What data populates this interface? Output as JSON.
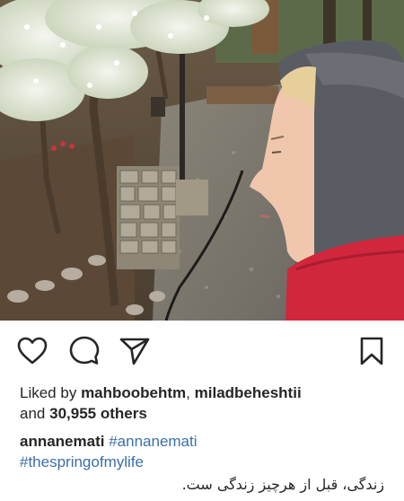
{
  "post": {
    "image_alt": "Woman in a gray hood and red jacket looking at a spring garden with blossoming trees and a stone pillar"
  },
  "actions": {
    "like_icon": "heart-icon",
    "comment_icon": "speech-bubble-icon",
    "share_icon": "paper-plane-icon",
    "save_icon": "bookmark-icon"
  },
  "likes": {
    "prefix": "Liked by",
    "user1": "mahboobehtm",
    "separator": ",",
    "user2": "miladbeheshtii",
    "and": "and",
    "count": "30,955 others"
  },
  "caption": {
    "username": "annanemati",
    "hashtag1": "#annanemati",
    "hashtag2": "#thespringofmylife",
    "text": "زندگی، قبل از هرچیز زندگی ست."
  },
  "colors": {
    "link": "#3b6fa8",
    "text": "#262626",
    "jacket": "#d0273d"
  }
}
